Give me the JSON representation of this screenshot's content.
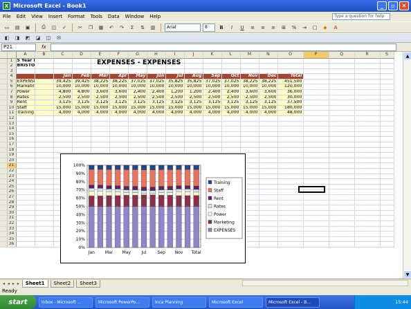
{
  "window": {
    "title": "Microsoft Excel - Book1",
    "minimize_label": "_",
    "restore_label": "▫",
    "close_label": "✕",
    "logo_label": "X"
  },
  "menu": {
    "items": [
      "File",
      "Edit",
      "View",
      "Insert",
      "Format",
      "Tools",
      "Data",
      "Window",
      "Help"
    ],
    "help_placeholder": "Type a question for help"
  },
  "toolbar": {
    "font_name": "Arial",
    "font_size": "8"
  },
  "formula_bar": {
    "name_box": "P21",
    "fx_label": "fx",
    "value": ""
  },
  "sheet": {
    "title": "EXPENSES - EXPENSES",
    "columns": [
      "A",
      "B",
      "C",
      "D",
      "E",
      "F",
      "G",
      "H",
      "I",
      "J",
      "K",
      "L",
      "M",
      "N",
      "O",
      "P",
      "Q",
      "R",
      "S"
    ],
    "selected_column": "P",
    "selected_row": 21,
    "row_count": 36,
    "a1": "5 Year Plan",
    "a2": "BRISTOL",
    "months": [
      "Jan",
      "Feb",
      "Mar",
      "Apr",
      "May",
      "Jun",
      "Jul",
      "Aug",
      "Sep",
      "Oct",
      "Nov",
      "Dec",
      "Total"
    ],
    "data_rows": [
      {
        "label": "EXPENSES",
        "values": [
          "39,425",
          "39,425",
          "38,225",
          "38,225",
          "37,025",
          "37,025",
          "35,825",
          "35,825",
          "37,025",
          "37,025",
          "38,225",
          "38,225",
          "451,500"
        ]
      },
      {
        "label": "Marketing",
        "values": [
          "10,000",
          "10,000",
          "10,000",
          "10,000",
          "10,000",
          "10,000",
          "10,000",
          "10,000",
          "10,000",
          "10,000",
          "10,000",
          "10,000",
          "120,000"
        ]
      },
      {
        "label": "Power",
        "values": [
          "4,800",
          "4,800",
          "3,600",
          "3,600",
          "2,400",
          "2,400",
          "1,200",
          "1,200",
          "2,400",
          "2,400",
          "3,600",
          "3,600",
          "36,000"
        ]
      },
      {
        "label": "Rates",
        "values": [
          "2,500",
          "2,500",
          "2,500",
          "2,500",
          "2,500",
          "2,500",
          "2,500",
          "2,500",
          "2,500",
          "2,500",
          "2,500",
          "2,500",
          "30,000"
        ]
      },
      {
        "label": "Rent",
        "values": [
          "3,125",
          "3,125",
          "3,125",
          "3,125",
          "3,125",
          "3,125",
          "3,125",
          "3,125",
          "3,125",
          "3,125",
          "3,125",
          "3,125",
          "37,500"
        ]
      },
      {
        "label": "Staff",
        "values": [
          "15,000",
          "15,000",
          "15,000",
          "15,000",
          "15,000",
          "15,000",
          "15,000",
          "15,000",
          "15,000",
          "15,000",
          "15,000",
          "15,000",
          "180,000"
        ]
      },
      {
        "label": "Training",
        "values": [
          "4,000",
          "4,000",
          "4,000",
          "4,000",
          "4,000",
          "4,000",
          "4,000",
          "4,000",
          "4,000",
          "4,000",
          "4,000",
          "4,000",
          "48,000"
        ]
      }
    ]
  },
  "chart_data": {
    "type": "bar",
    "stacked": "100%",
    "categories": [
      "Jan",
      "Feb",
      "Mar",
      "Apr",
      "May",
      "Jun",
      "Jul",
      "Aug",
      "Sep",
      "Oct",
      "Nov",
      "Dec",
      "Total"
    ],
    "x_tick_labels": [
      "Jan",
      "Mar",
      "May",
      "Jul",
      "Sep",
      "Nov",
      "Total"
    ],
    "y_tick_labels": [
      "0%",
      "10%",
      "20%",
      "30%",
      "40%",
      "50%",
      "60%",
      "70%",
      "80%",
      "90%",
      "100%"
    ],
    "ylim": [
      0,
      100
    ],
    "legend_position": "right",
    "series": [
      {
        "name": "EXPENSES",
        "color": "#8e86c8",
        "values": [
          39425,
          39425,
          38225,
          38225,
          37025,
          37025,
          35825,
          35825,
          37025,
          37025,
          38225,
          38225,
          451500
        ]
      },
      {
        "name": "Marketing",
        "color": "#8d2f4a",
        "values": [
          10000,
          10000,
          10000,
          10000,
          10000,
          10000,
          10000,
          10000,
          10000,
          10000,
          10000,
          10000,
          120000
        ]
      },
      {
        "name": "Power",
        "color": "#fffcd0",
        "values": [
          4800,
          4800,
          3600,
          3600,
          2400,
          2400,
          1200,
          1200,
          2400,
          2400,
          3600,
          3600,
          36000
        ]
      },
      {
        "name": "Rates",
        "color": "#cfe9ef",
        "values": [
          2500,
          2500,
          2500,
          2500,
          2500,
          2500,
          2500,
          2500,
          2500,
          2500,
          2500,
          2500,
          30000
        ]
      },
      {
        "name": "Rent",
        "color": "#5c2465",
        "values": [
          3125,
          3125,
          3125,
          3125,
          3125,
          3125,
          3125,
          3125,
          3125,
          3125,
          3125,
          3125,
          37500
        ]
      },
      {
        "name": "Staff",
        "color": "#e9745e",
        "values": [
          15000,
          15000,
          15000,
          15000,
          15000,
          15000,
          15000,
          15000,
          15000,
          15000,
          15000,
          15000,
          180000
        ]
      },
      {
        "name": "Training",
        "color": "#1f4a87",
        "values": [
          4000,
          4000,
          4000,
          4000,
          4000,
          4000,
          4000,
          4000,
          4000,
          4000,
          4000,
          4000,
          48000
        ]
      }
    ]
  },
  "sheet_tabs": [
    "Sheet1",
    "Sheet2",
    "Sheet3"
  ],
  "sheet_tab_nav": "◂ ◂ ▸ ▸",
  "status": "Ready",
  "taskbar": {
    "start_label": "start",
    "tasks": [
      "Inbox - Microsoft ...",
      "Microsoft PowerPo...",
      "Inca Planning",
      "Microsoft Excel",
      "Microsoft Excel - B..."
    ],
    "clock": "15:44"
  }
}
